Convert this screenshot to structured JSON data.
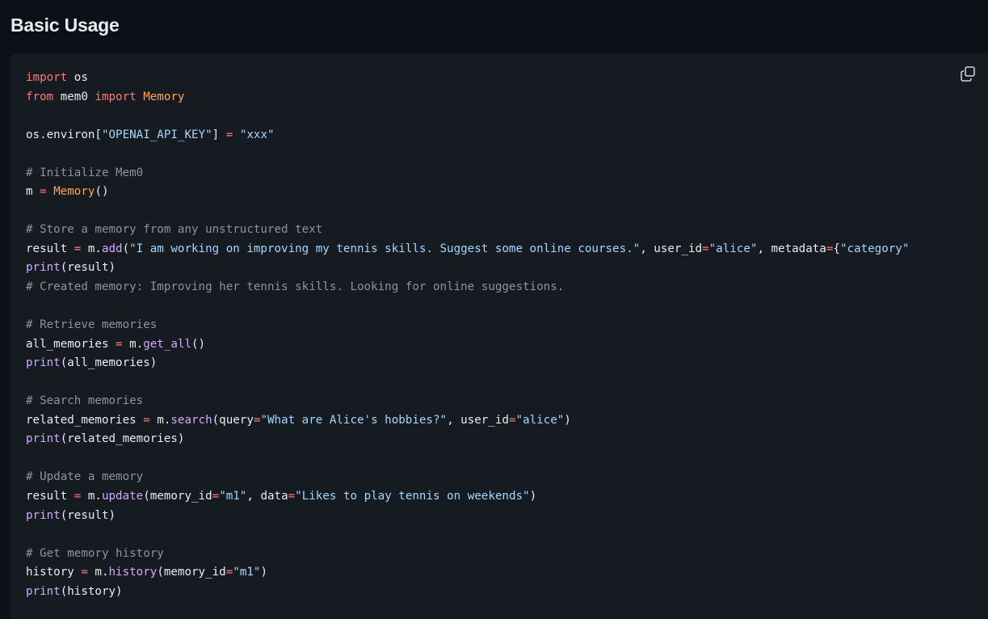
{
  "section": {
    "title": "Basic Usage"
  },
  "copy_button": {
    "icon": "copy-icon"
  },
  "theme": {
    "background": "#0d1117",
    "code_background": "#161b22",
    "keyword": "#ff7b72",
    "class": "#ffa657",
    "function": "#d2a8ff",
    "string": "#a5d6ff",
    "comment": "#8b949e",
    "text": "#e6edf3"
  },
  "code_lines": [
    [
      {
        "t": "kw",
        "v": "import"
      },
      {
        "t": "plain",
        "v": " os"
      }
    ],
    [
      {
        "t": "kw",
        "v": "from"
      },
      {
        "t": "plain",
        "v": " mem0 "
      },
      {
        "t": "kw",
        "v": "import"
      },
      {
        "t": "plain",
        "v": " "
      },
      {
        "t": "cls",
        "v": "Memory"
      }
    ],
    [],
    [
      {
        "t": "plain",
        "v": "os.environ["
      },
      {
        "t": "str",
        "v": "\"OPENAI_API_KEY\""
      },
      {
        "t": "plain",
        "v": "] "
      },
      {
        "t": "op",
        "v": "="
      },
      {
        "t": "plain",
        "v": " "
      },
      {
        "t": "str",
        "v": "\"xxx\""
      }
    ],
    [],
    [
      {
        "t": "cm",
        "v": "# Initialize Mem0"
      }
    ],
    [
      {
        "t": "plain",
        "v": "m "
      },
      {
        "t": "op",
        "v": "="
      },
      {
        "t": "plain",
        "v": " "
      },
      {
        "t": "cls",
        "v": "Memory"
      },
      {
        "t": "plain",
        "v": "()"
      }
    ],
    [],
    [
      {
        "t": "cm",
        "v": "# Store a memory from any unstructured text"
      }
    ],
    [
      {
        "t": "plain",
        "v": "result "
      },
      {
        "t": "op",
        "v": "="
      },
      {
        "t": "plain",
        "v": " m."
      },
      {
        "t": "fn",
        "v": "add"
      },
      {
        "t": "plain",
        "v": "("
      },
      {
        "t": "str",
        "v": "\"I am working on improving my tennis skills. Suggest some online courses.\""
      },
      {
        "t": "plain",
        "v": ", user_id"
      },
      {
        "t": "op",
        "v": "="
      },
      {
        "t": "str",
        "v": "\"alice\""
      },
      {
        "t": "plain",
        "v": ", metadata"
      },
      {
        "t": "op",
        "v": "="
      },
      {
        "t": "plain",
        "v": "{"
      },
      {
        "t": "str",
        "v": "\"category\""
      }
    ],
    [
      {
        "t": "fn",
        "v": "print"
      },
      {
        "t": "plain",
        "v": "(result)"
      }
    ],
    [
      {
        "t": "cm",
        "v": "# Created memory: Improving her tennis skills. Looking for online suggestions."
      }
    ],
    [],
    [
      {
        "t": "cm",
        "v": "# Retrieve memories"
      }
    ],
    [
      {
        "t": "plain",
        "v": "all_memories "
      },
      {
        "t": "op",
        "v": "="
      },
      {
        "t": "plain",
        "v": " m."
      },
      {
        "t": "fn",
        "v": "get_all"
      },
      {
        "t": "plain",
        "v": "()"
      }
    ],
    [
      {
        "t": "fn",
        "v": "print"
      },
      {
        "t": "plain",
        "v": "(all_memories)"
      }
    ],
    [],
    [
      {
        "t": "cm",
        "v": "# Search memories"
      }
    ],
    [
      {
        "t": "plain",
        "v": "related_memories "
      },
      {
        "t": "op",
        "v": "="
      },
      {
        "t": "plain",
        "v": " m."
      },
      {
        "t": "fn",
        "v": "search"
      },
      {
        "t": "plain",
        "v": "(query"
      },
      {
        "t": "op",
        "v": "="
      },
      {
        "t": "str",
        "v": "\"What are Alice's hobbies?\""
      },
      {
        "t": "plain",
        "v": ", user_id"
      },
      {
        "t": "op",
        "v": "="
      },
      {
        "t": "str",
        "v": "\"alice\""
      },
      {
        "t": "plain",
        "v": ")"
      }
    ],
    [
      {
        "t": "fn",
        "v": "print"
      },
      {
        "t": "plain",
        "v": "(related_memories)"
      }
    ],
    [],
    [
      {
        "t": "cm",
        "v": "# Update a memory"
      }
    ],
    [
      {
        "t": "plain",
        "v": "result "
      },
      {
        "t": "op",
        "v": "="
      },
      {
        "t": "plain",
        "v": " m."
      },
      {
        "t": "fn",
        "v": "update"
      },
      {
        "t": "plain",
        "v": "(memory_id"
      },
      {
        "t": "op",
        "v": "="
      },
      {
        "t": "str",
        "v": "\"m1\""
      },
      {
        "t": "plain",
        "v": ", data"
      },
      {
        "t": "op",
        "v": "="
      },
      {
        "t": "str",
        "v": "\"Likes to play tennis on weekends\""
      },
      {
        "t": "plain",
        "v": ")"
      }
    ],
    [
      {
        "t": "fn",
        "v": "print"
      },
      {
        "t": "plain",
        "v": "(result)"
      }
    ],
    [],
    [
      {
        "t": "cm",
        "v": "# Get memory history"
      }
    ],
    [
      {
        "t": "plain",
        "v": "history "
      },
      {
        "t": "op",
        "v": "="
      },
      {
        "t": "plain",
        "v": " m."
      },
      {
        "t": "fn",
        "v": "history"
      },
      {
        "t": "plain",
        "v": "(memory_id"
      },
      {
        "t": "op",
        "v": "="
      },
      {
        "t": "str",
        "v": "\"m1\""
      },
      {
        "t": "plain",
        "v": ")"
      }
    ],
    [
      {
        "t": "fn",
        "v": "print"
      },
      {
        "t": "plain",
        "v": "(history)"
      }
    ]
  ]
}
